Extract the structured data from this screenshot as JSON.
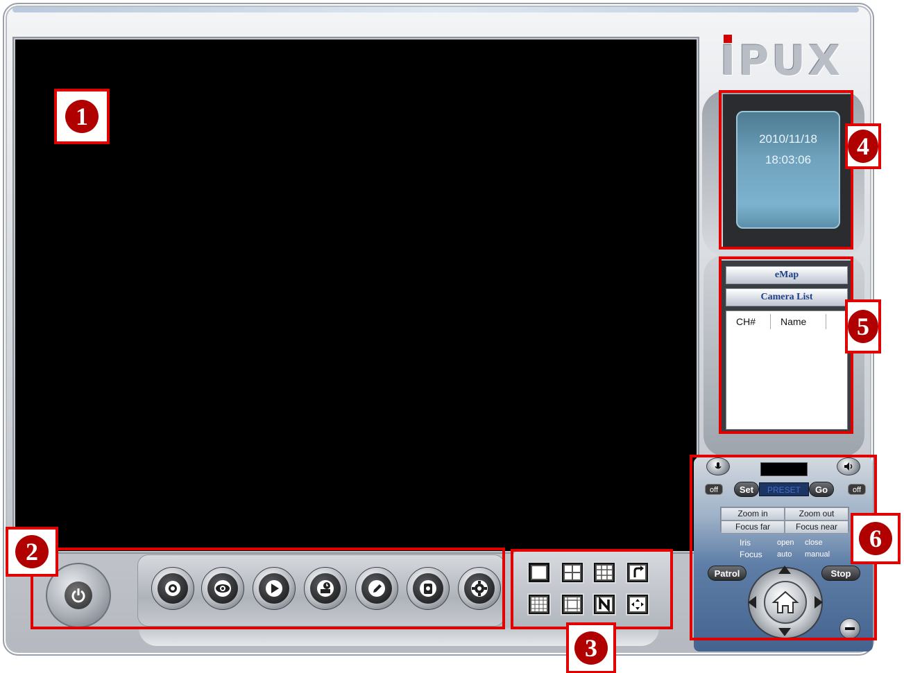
{
  "app": {
    "logo_text": "IPUX"
  },
  "callouts": {
    "c1": "1",
    "c2": "2",
    "c3": "3",
    "c4": "4",
    "c5": "5",
    "c6": "6"
  },
  "clock": {
    "date": "2010/11/18",
    "time": "18:03:06"
  },
  "camera_panel": {
    "emap_tab": "eMap",
    "camera_list_tab": "Camera List",
    "columns": [
      "CH#",
      "Name"
    ]
  },
  "ptz": {
    "off_left": "off",
    "off_right": "off",
    "set_label": "Set",
    "preset_placeholder": "PRESET",
    "go_label": "Go",
    "zoom_in": "Zoom in",
    "zoom_out": "Zoom out",
    "focus_far": "Focus far",
    "focus_near": "Focus near",
    "iris_label": "Iris",
    "focus_label": "Focus",
    "open_label": "open",
    "close_label": "close",
    "auto_label": "auto",
    "manual_label": "manual",
    "patrol_label": "Patrol",
    "stop_label": "Stop"
  },
  "toolbar": {
    "icons": [
      "power-icon",
      "record-icon",
      "watch-icon",
      "play-icon",
      "schedule-icon",
      "edit-icon",
      "snapshot-icon",
      "settings-icon"
    ]
  },
  "layouts": [
    "single-view",
    "quad-view",
    "nine-view",
    "rotate-view",
    "sixteen-view",
    "thirteen-view",
    "n-view",
    "fullscreen-view"
  ],
  "colors": {
    "callout_red": "#e00000",
    "accent_blue": "#1c3f86",
    "clock_screen": "#6fa2bd"
  }
}
